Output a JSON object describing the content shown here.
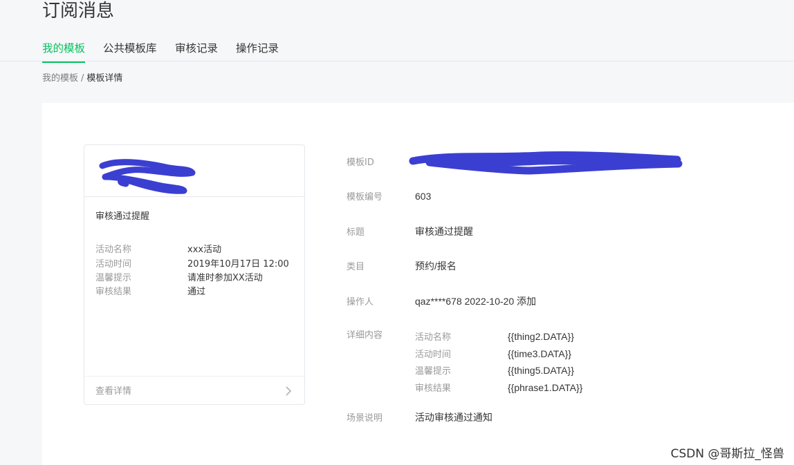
{
  "header": {
    "title": "订阅消息"
  },
  "tabs": [
    {
      "label": "我的模板",
      "active": true
    },
    {
      "label": "公共模板库",
      "active": false
    },
    {
      "label": "审核记录",
      "active": false
    },
    {
      "label": "操作记录",
      "active": false
    }
  ],
  "breadcrumb": {
    "parent": "我的模板",
    "separator": "/",
    "current": "模板详情"
  },
  "preview_card": {
    "title": "审核通过提醒",
    "fields": [
      {
        "name": "活动名称",
        "value": "xxx活动"
      },
      {
        "name": "活动时间",
        "value": "2019年10月17日 12:00"
      },
      {
        "name": "温馨提示",
        "value": "请准时参加XX活动"
      },
      {
        "name": "审核结果",
        "value": "通过"
      }
    ],
    "footer_label": "查看详情",
    "footer_icon": "chevron-right-icon"
  },
  "details": {
    "template_id": {
      "label": "模板ID",
      "value": ""
    },
    "template_no": {
      "label": "模板编号",
      "value": "603"
    },
    "title": {
      "label": "标题",
      "value": "审核通过提醒"
    },
    "category": {
      "label": "类目",
      "value": "预约/报名"
    },
    "operator": {
      "label": "操作人",
      "value": "qaz****678 2022-10-20 添加"
    },
    "content": {
      "label": "详细内容",
      "items": [
        {
          "name": "活动名称",
          "value": "{{thing2.DATA}}"
        },
        {
          "name": "活动时间",
          "value": "{{time3.DATA}}"
        },
        {
          "name": "温馨提示",
          "value": "{{thing5.DATA}}"
        },
        {
          "name": "审核结果",
          "value": "{{phrase1.DATA}}"
        }
      ]
    },
    "scene": {
      "label": "场景说明",
      "value": "活动审核通过通知"
    }
  },
  "watermark": "CSDN @哥斯拉_怪兽",
  "colors": {
    "accent": "#07c160",
    "redaction": "#3b3fd1"
  }
}
